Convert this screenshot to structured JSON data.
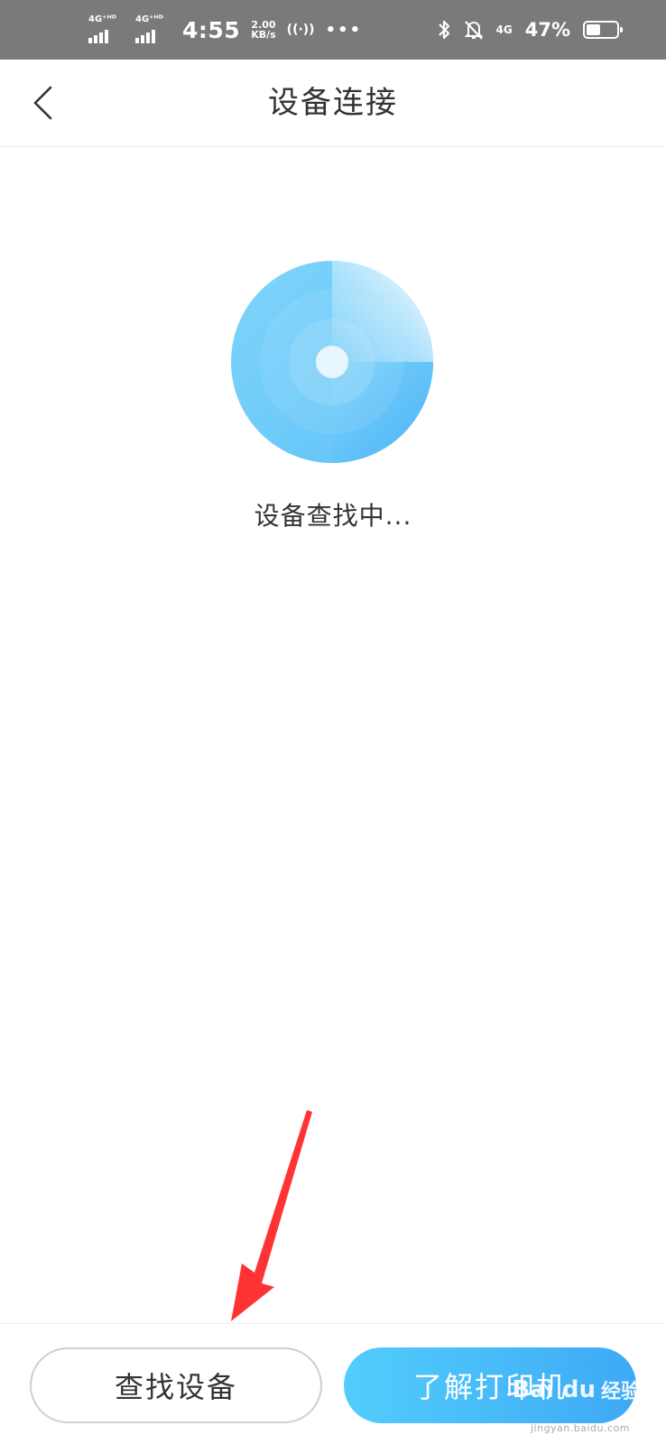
{
  "status_bar": {
    "sim1": "4G⁺ᴴᴰ",
    "sim2": "4G⁺ᴴᴰ",
    "time": "4:55",
    "speed_value": "2.00",
    "speed_unit": "KB/s",
    "hotspot": "((·))",
    "more": "•••",
    "network": "4G",
    "battery_percent": "47%",
    "battery_level": 0.47
  },
  "header": {
    "title": "设备连接"
  },
  "main": {
    "status_text": "设备查找中..."
  },
  "buttons": {
    "find": "查找设备",
    "learn": "了解打印机"
  },
  "watermark": {
    "brand": "Bai du",
    "cn": "经验",
    "url": "jingyan.baidu.com"
  },
  "colors": {
    "accent": "#4ab8f8",
    "status_bar": "#7a7a7a",
    "annotation": "#ff3333"
  },
  "icons": {
    "back": "chevron-left-icon",
    "radar": "radar-scan-icon",
    "bluetooth": "bluetooth-icon",
    "mute": "bell-off-icon",
    "battery": "battery-icon"
  }
}
